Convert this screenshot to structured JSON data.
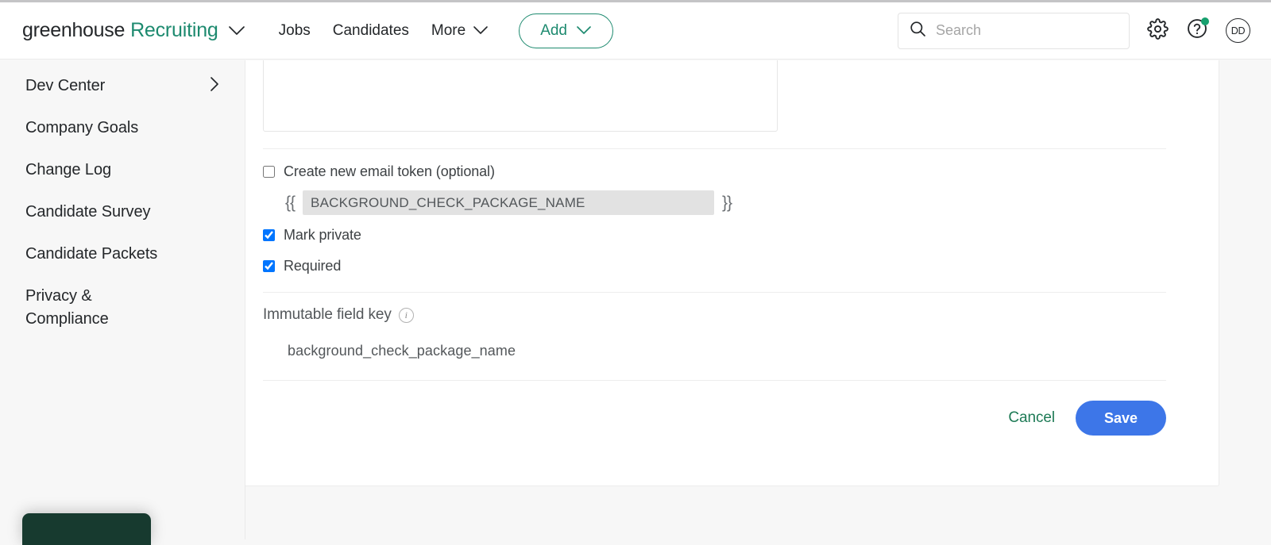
{
  "brand": {
    "name": "greenhouse",
    "product": "Recruiting",
    "caret_icon": "chevron-down-icon"
  },
  "topnav": {
    "links": [
      {
        "label": "Jobs",
        "caret": false
      },
      {
        "label": "Candidates",
        "caret": false
      },
      {
        "label": "More",
        "caret": true
      }
    ],
    "add_button": {
      "label": "Add",
      "caret_icon": "chevron-down-icon"
    },
    "search": {
      "placeholder": "Search",
      "value": "",
      "icon": "search-icon"
    },
    "settings_icon": "gear-icon",
    "help_icon": "question-mark-icon",
    "help_badge_color": "#17a06e",
    "avatar_initials": "DD"
  },
  "sidebar": {
    "items": [
      {
        "label": "Dev Center",
        "chevron": true
      },
      {
        "label": "Company Goals",
        "chevron": false
      },
      {
        "label": "Change Log",
        "chevron": false
      },
      {
        "label": "Candidate Survey",
        "chevron": false
      },
      {
        "label": "Candidate Packets",
        "chevron": false
      },
      {
        "label": "Privacy &\nCompliance",
        "chevron": false
      }
    ],
    "chevron_icon": "chevron-right-icon"
  },
  "form": {
    "description_textarea": {
      "value": "",
      "placeholder": ""
    },
    "email_token": {
      "checkbox_label": "Create new email token (optional)",
      "checked": false,
      "brace_open": "{{",
      "brace_close": "}}",
      "token_value": "BACKGROUND_CHECK_PACKAGE_NAME",
      "token_disabled": true
    },
    "mark_private": {
      "label": "Mark private",
      "checked": true
    },
    "required": {
      "label": "Required",
      "checked": true
    },
    "immutable_field": {
      "label": "Immutable field key",
      "info_icon": "info-circle-icon",
      "value": "background_check_package_name"
    },
    "actions": {
      "cancel_label": "Cancel",
      "save_label": "Save",
      "save_color": "#3d76e8",
      "cancel_color": "#1d7a55"
    }
  },
  "toast": {
    "color": "#173a2f"
  },
  "theme": {
    "brand_green": "#1d8a6f",
    "page_background": "#f7f7f7",
    "card_background": "#ffffff"
  }
}
